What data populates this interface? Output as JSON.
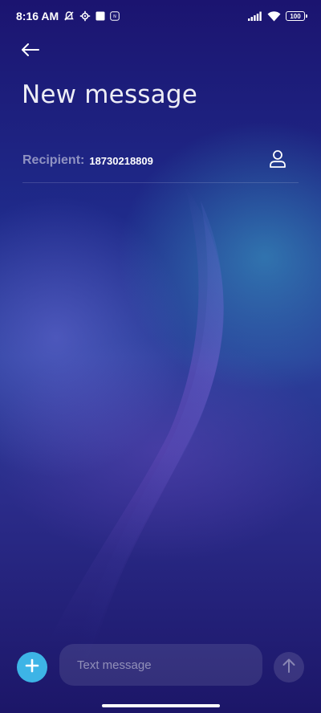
{
  "status_bar": {
    "time": "8:16 AM",
    "battery": "100",
    "icons": [
      "muted-alarm-icon",
      "settings-gear-icon",
      "square-notification-icon",
      "nfc-icon",
      "signal-icon",
      "wifi-icon",
      "battery-icon"
    ]
  },
  "header": {
    "back_icon": "arrow-left-icon",
    "title": "New message"
  },
  "recipient": {
    "label": "Recipient:",
    "value": "18730218809",
    "contact_icon": "person-icon"
  },
  "compose": {
    "add_icon": "plus-icon",
    "placeholder": "Text message",
    "send_icon": "arrow-up-icon"
  },
  "colors": {
    "accent": "#3db4e6",
    "background": "#1b1470"
  }
}
